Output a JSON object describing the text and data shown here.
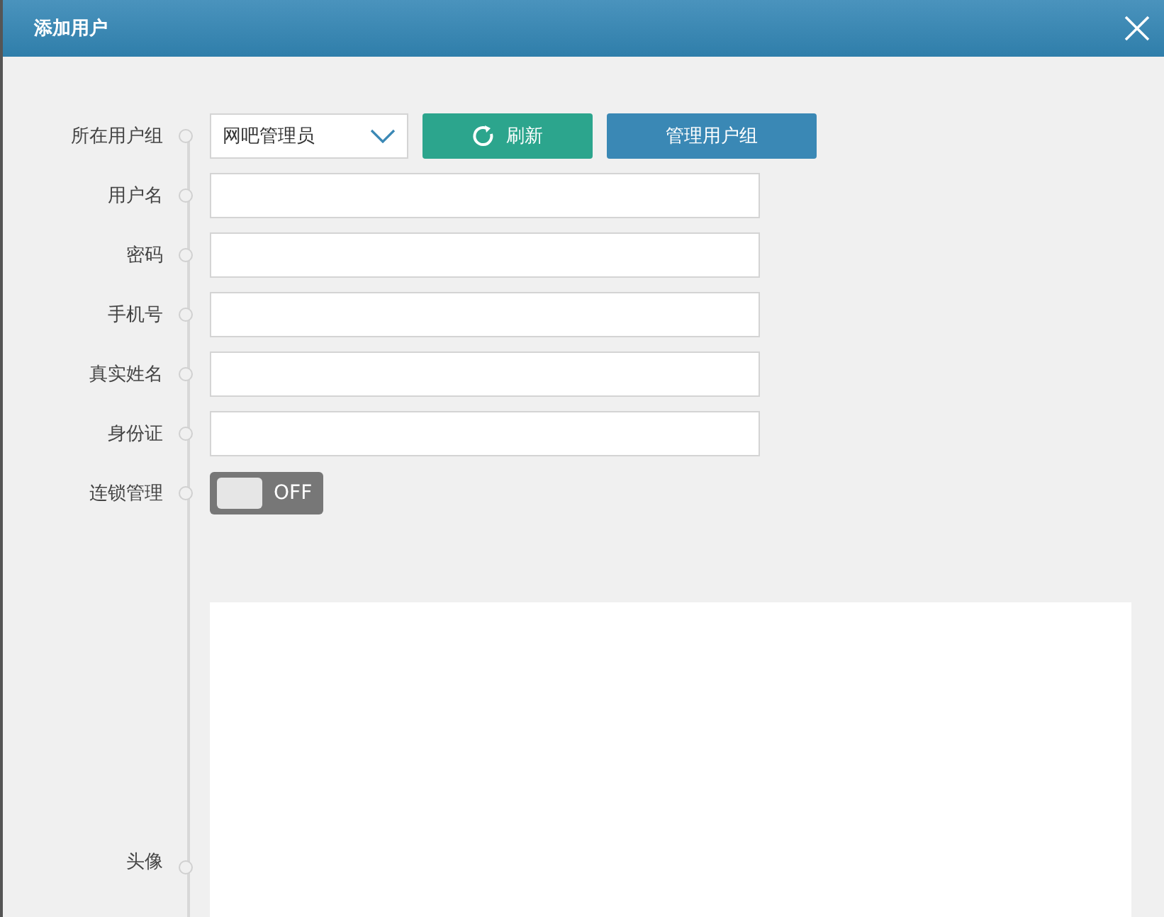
{
  "dialog": {
    "title": "添加用户"
  },
  "fields": [
    {
      "kind": "select",
      "label": "所在用户组",
      "value": "网吧管理员",
      "buttons": [
        {
          "kind": "refresh",
          "label": "刷新"
        },
        {
          "kind": "primary",
          "label": "管理用户组"
        }
      ]
    },
    {
      "kind": "text",
      "label": "用户名"
    },
    {
      "kind": "text",
      "label": "密码"
    },
    {
      "kind": "text",
      "label": "手机号"
    },
    {
      "kind": "text",
      "label": "真实姓名"
    },
    {
      "kind": "text",
      "label": "身份证"
    },
    {
      "kind": "toggle",
      "label": "连锁管理",
      "on": false,
      "text": "OFF"
    },
    {
      "kind": "image",
      "label": "头像"
    }
  ]
}
